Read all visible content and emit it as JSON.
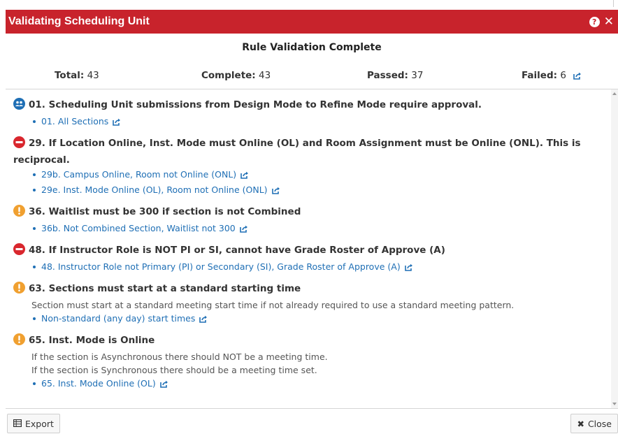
{
  "dialog": {
    "title": "Validating Scheduling Unit",
    "help_glyph": "?",
    "close_glyph": "✕"
  },
  "status": {
    "heading": "Rule Validation Complete"
  },
  "stats": {
    "total_label": "Total:",
    "total_value": "43",
    "complete_label": "Complete:",
    "complete_value": "43",
    "passed_label": "Passed:",
    "passed_value": "37",
    "failed_label": "Failed:",
    "failed_value": "6"
  },
  "rules": [
    {
      "severity": "approval",
      "icon": "users-icon",
      "title": "01. Scheduling Unit submissions from Design Mode to Refine Mode require approval.",
      "descriptions": [],
      "items": [
        "01. All Sections"
      ]
    },
    {
      "severity": "error",
      "icon": "no-entry-icon",
      "title": "29. If Location Online, Inst. Mode must Online (OL) and Room Assignment must be Online (ONL). This is reciprocal.",
      "descriptions": [],
      "items": [
        "29b. Campus Online, Room not Online (ONL)",
        "29e. Inst. Mode Online (OL), Room not Online (ONL)"
      ]
    },
    {
      "severity": "warning",
      "icon": "exclamation-icon",
      "title": "36. Waitlist must be 300 if section is not Combined",
      "descriptions": [],
      "items": [
        "36b. Not Combined Section, Waitlist not 300"
      ]
    },
    {
      "severity": "error",
      "icon": "no-entry-icon",
      "title": "48. If Instructor Role is NOT PI or SI, cannot have Grade Roster of Approve (A)",
      "descriptions": [],
      "items": [
        "48. Instructor Role not Primary (PI) or Secondary (SI), Grade Roster of Approve (A)"
      ]
    },
    {
      "severity": "warning",
      "icon": "exclamation-icon",
      "title": "63. Sections must start at a standard starting time",
      "descriptions": [
        "Section must start at a standard meeting start time if not already required to use a standard meeting pattern."
      ],
      "items": [
        "Non-standard (any day) start times"
      ]
    },
    {
      "severity": "warning",
      "icon": "exclamation-icon",
      "title": "65. Inst. Mode is Online",
      "descriptions": [
        "If the section is Asynchronous there should NOT be a meeting time.",
        "If the section is Synchronous there should be a meeting time set."
      ],
      "items": [
        "65. Inst. Mode Online (OL)"
      ]
    }
  ],
  "footer": {
    "export_label": "Export",
    "close_label": "Close"
  },
  "colors": {
    "titlebar": "#c8232c",
    "link": "#1f6fb5",
    "approval": "#1f6fb5",
    "error": "#d9272e",
    "warning": "#f0a030"
  }
}
